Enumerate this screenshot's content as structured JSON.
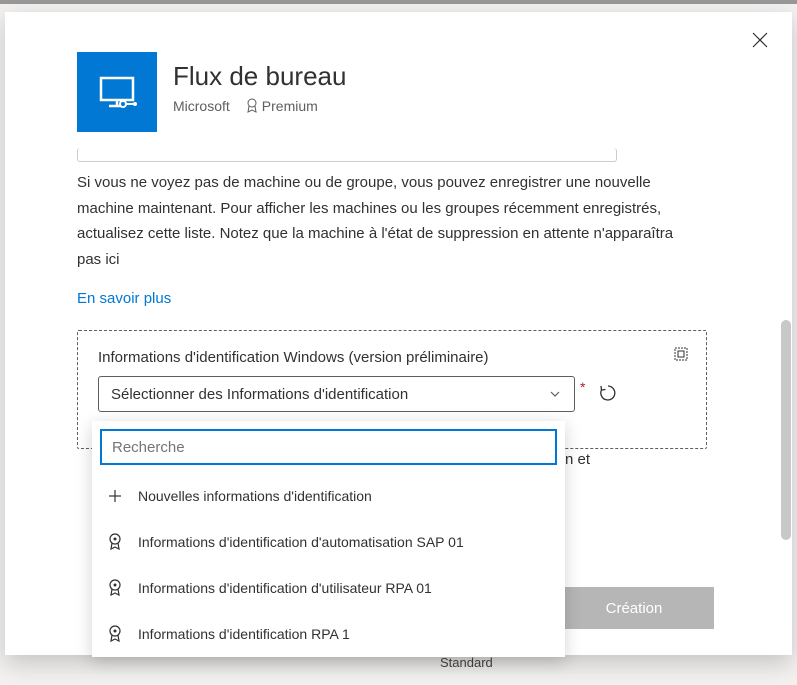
{
  "header": {
    "title": "Flux de bureau",
    "publisher": "Microsoft",
    "premium": "Premium"
  },
  "content": {
    "info_text": "Si vous ne voyez pas de machine ou de groupe, vous pouvez enregistrer une nouvelle machine maintenant. Pour afficher les machines ou les groupes récemment enregistrés, actualisez cette liste. Notez que la machine à l'état de suppression en attente n'apparaîtra pas ici",
    "learn_more": "En savoir plus",
    "section_label": "Informations d'identification Windows (version préliminaire)",
    "select_placeholder": "Sélectionner des Informations d'identification",
    "partial_text": "n et"
  },
  "dropdown": {
    "search_placeholder": "Recherche",
    "new_credentials": "Nouvelles informations d'identification",
    "items": [
      "Informations d'identification d'automatisation SAP 01",
      "Informations d'identification d'utilisateur RPA 01",
      "Informations d'identification RPA 1"
    ]
  },
  "create_button": "Création",
  "footer": "Standard"
}
